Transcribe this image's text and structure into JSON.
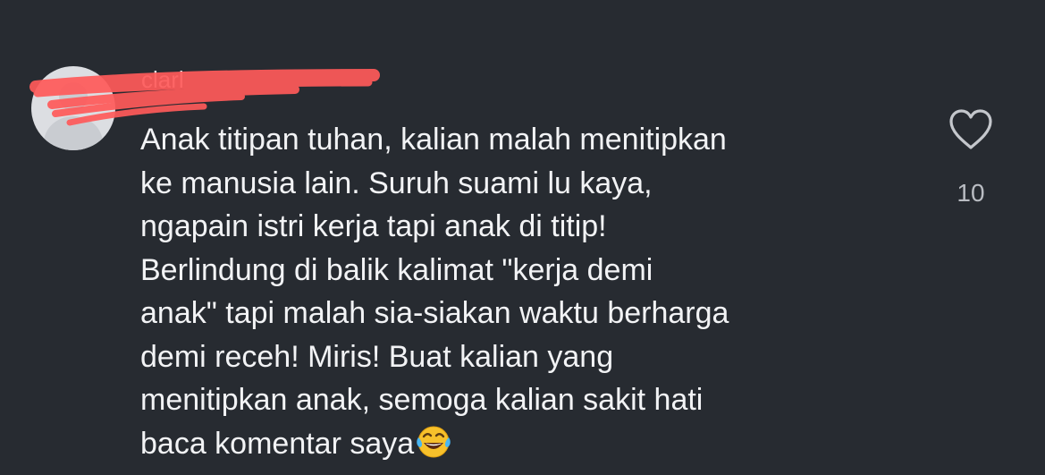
{
  "comment": {
    "username": "clarl",
    "text": "Anak titipan tuhan, kalian malah menitipkan\nke manusia lain. Suruh suami lu kaya,\nngapain istri kerja tapi anak di titip!\nBerlindung di balik kalimat \"kerja demi\nanak\" tapi malah sia-siakan waktu berharga\ndemi receh! Miris! Buat kalian yang\nmenitipkan anak, semoga kalian sakit hati\nbaca komentar saya",
    "emoji": "face-with-tears-of-joy",
    "like_count": "10"
  },
  "icons": {
    "like": "heart-outline-icon",
    "avatar": "default-user-avatar"
  },
  "colors": {
    "background": "#272b31",
    "text": "#f2f3f5",
    "muted": "#b9bcc2",
    "redaction": "#ff5a5a"
  }
}
